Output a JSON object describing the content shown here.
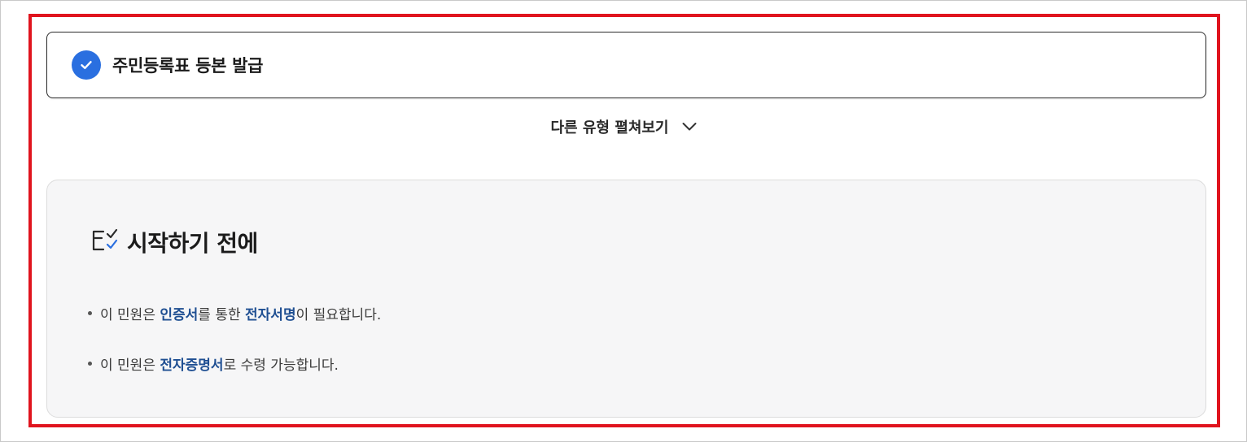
{
  "selected_item": {
    "title": "주민등록표 등본 발급"
  },
  "expand_toggle": {
    "label": "다른 유형 펼쳐보기"
  },
  "before_start": {
    "heading": "시작하기 전에",
    "notices": [
      {
        "prefix": "이 민원은 ",
        "hl1": "인증서",
        "mid": "를 통한 ",
        "hl2": "전자서명",
        "suffix": "이 필요합니다."
      },
      {
        "prefix": "이 민원은 ",
        "hl1": "전자증명서",
        "suffix": "로 수령 가능합니다."
      }
    ]
  },
  "colors": {
    "accent_blue": "#2a6fe0",
    "highlight_text": "#1f4f92",
    "annotation_red": "#e0141e"
  }
}
